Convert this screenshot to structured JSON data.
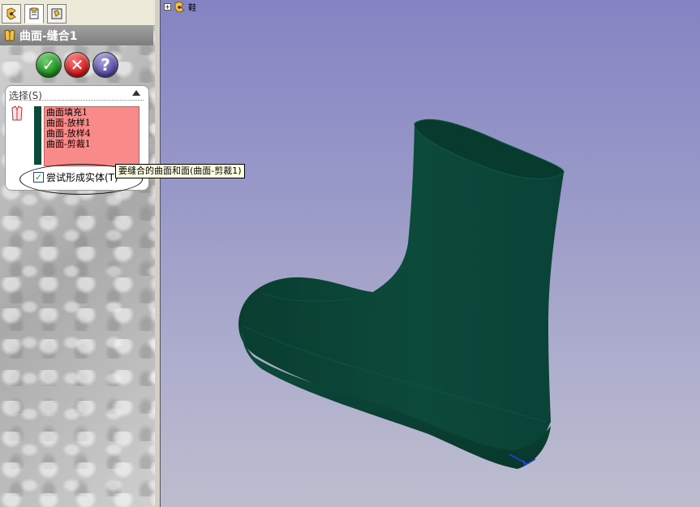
{
  "tabs": [
    {
      "name": "feature-manager"
    },
    {
      "name": "property-manager"
    },
    {
      "name": "configuration-manager"
    }
  ],
  "panel": {
    "title": "曲面-缝合1"
  },
  "buttons": {
    "ok": "✓",
    "cancel": "✕",
    "help": "?"
  },
  "selection": {
    "header": "选择(S)",
    "faces": [
      "曲面填充1",
      "曲面-放样1",
      "曲面-放样4",
      "曲面-剪裁1"
    ],
    "solid_label": "尝试形成实体(T)",
    "solid_checked": true,
    "checkbox_mark": "✓"
  },
  "tooltip": "要缝合的曲面和面(曲面-剪裁1)",
  "tree": {
    "expander": "+",
    "node_label": "鞋"
  },
  "colors": {
    "model": "#0b4a3b",
    "faces_list_bg": "#f98a8a",
    "viewport_top": "#8484c4",
    "viewport_bottom": "#bdbdcf"
  }
}
